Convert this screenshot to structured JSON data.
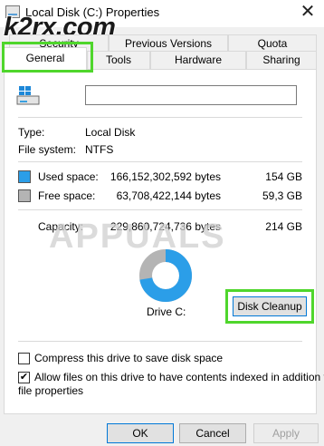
{
  "window": {
    "title": "Local Disk (C:) Properties",
    "close_glyph": "✕",
    "watermark": "k2rx.com"
  },
  "tabs": {
    "security": "Security",
    "previous_versions": "Previous Versions",
    "quota": "Quota",
    "general": "General",
    "tools": "Tools",
    "hardware": "Hardware",
    "sharing": "Sharing"
  },
  "general": {
    "name_value": "",
    "type_label": "Type:",
    "type_value": "Local Disk",
    "fs_label": "File system:",
    "fs_value": "NTFS",
    "used_label": "Used space:",
    "used_bytes": "166,152,302,592 bytes",
    "used_size": "154 GB",
    "free_label": "Free space:",
    "free_bytes": "63,708,422,144 bytes",
    "free_size": "59,3 GB",
    "capacity_label": "Capacity:",
    "capacity_bytes": "229,860,724,736 bytes",
    "capacity_size": "214 GB",
    "drive_label": "Drive C:",
    "cleanup_label": "Disk Cleanup",
    "compress_label": "Compress this drive to save disk space",
    "compress_checked": false,
    "index_label_line1": "Allow files on this drive to have contents indexed in addition to",
    "index_label_line2": "file properties",
    "index_checked": true,
    "used_fraction": 0.723,
    "used_color": "#2b9ee8",
    "free_color": "#b4b4b4",
    "overlay_watermark": "APPUALS"
  },
  "buttons": {
    "ok": "OK",
    "cancel": "Cancel",
    "apply": "Apply"
  },
  "highlight_color": "#4fd62c"
}
